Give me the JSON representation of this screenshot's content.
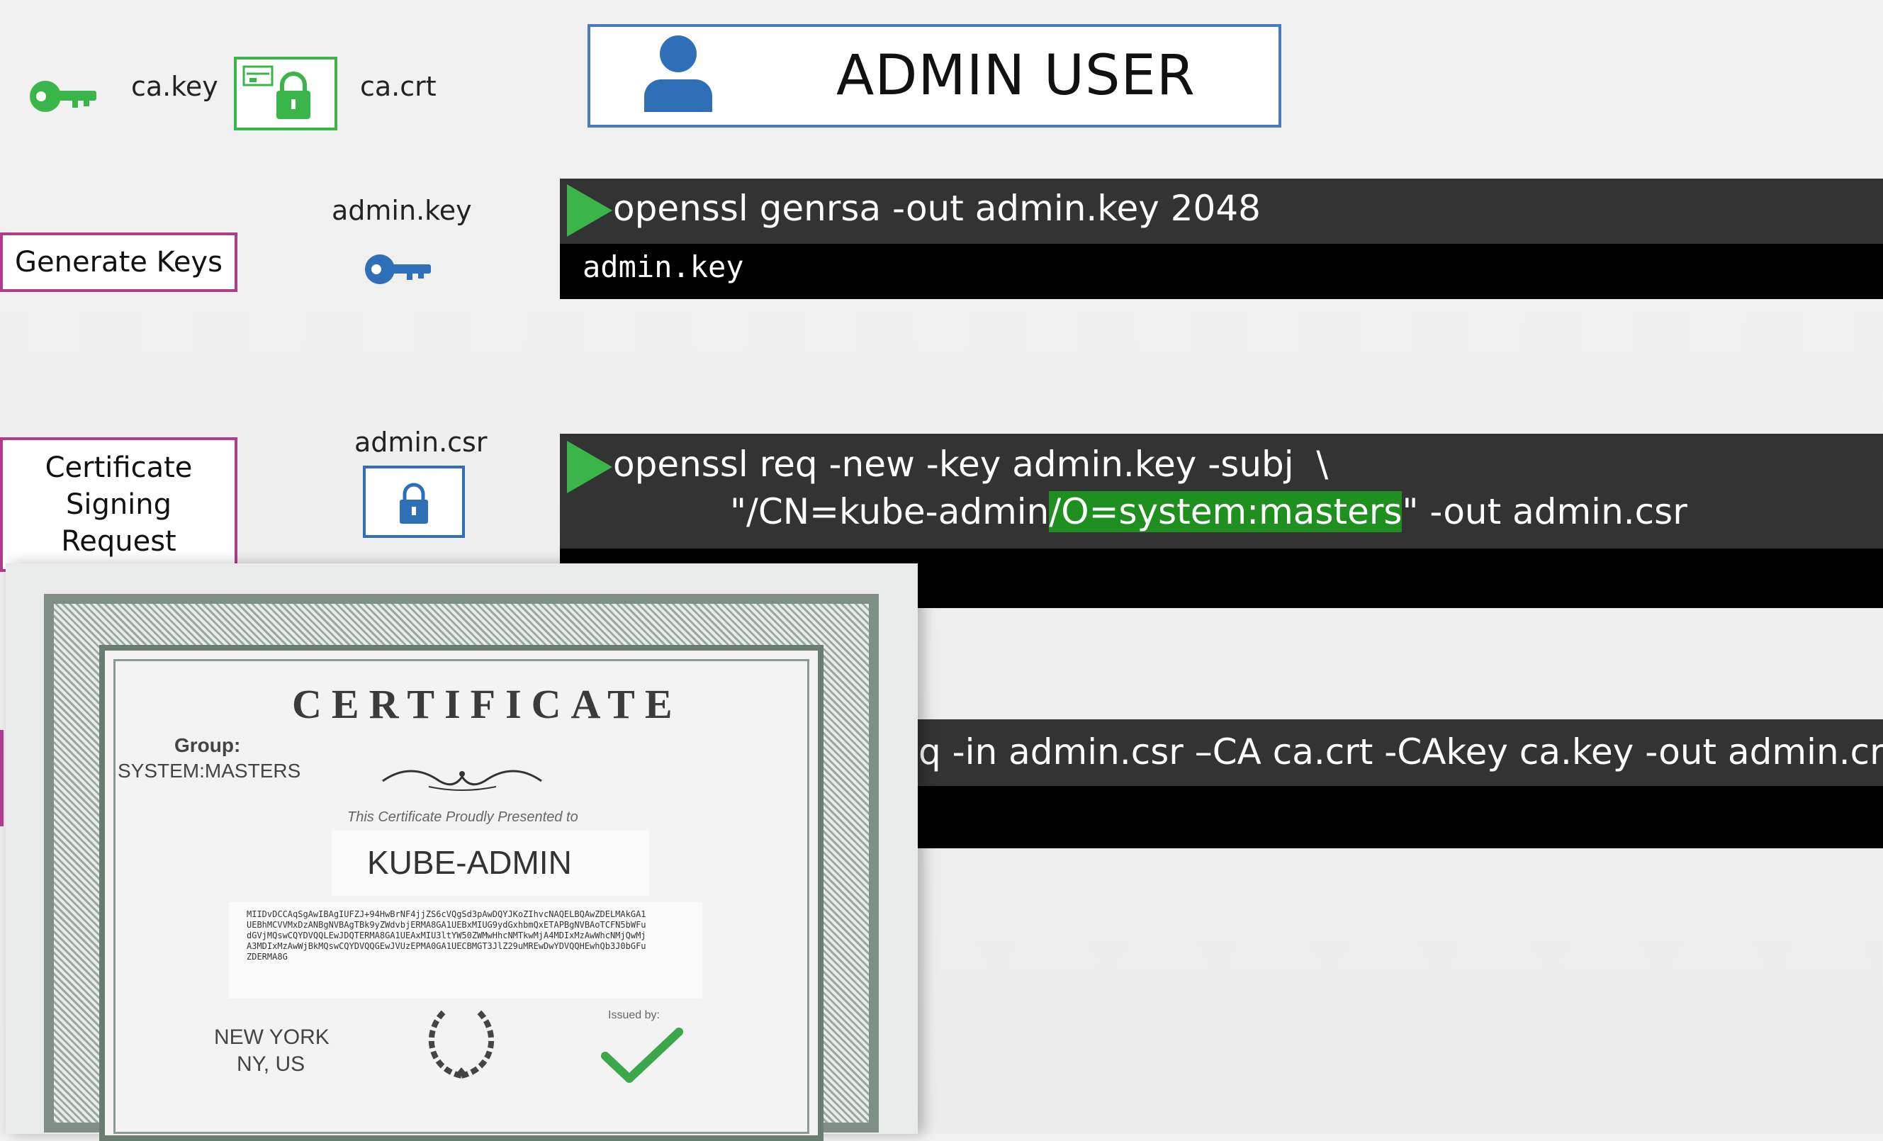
{
  "ca": {
    "key_label": "ca.key",
    "crt_label": "ca.crt"
  },
  "title": "ADMIN USER",
  "steps": {
    "generate_keys": "Generate Keys",
    "csr_line1": "Certificate",
    "csr_line2": "Signing",
    "csr_line3": "Request"
  },
  "files": {
    "admin_key": "admin.key",
    "admin_csr": "admin.csr"
  },
  "terminal1": {
    "command": "openssl genrsa -out admin.key 2048",
    "output": "admin.key"
  },
  "terminal2": {
    "line1": "openssl req -new -key admin.key -subj  \\",
    "line2_pre": "\"/CN=kube-admin",
    "line2_highlight": "/O=system:masters",
    "line2_post": "\" -out admin.csr"
  },
  "terminal3": {
    "command_visible": "q -in admin.csr –CA ca.crt -CAkey ca.key -out admin.crt"
  },
  "certificate": {
    "heading": "CERTIFICATE",
    "group_label": "Group:",
    "group_value": "SYSTEM:MASTERS",
    "presented_to": "This Certificate Proudly Presented to",
    "recipient": "KUBE-ADMIN",
    "hash_text": "MIIDvDCCAqSgAwIBAgIUFZJ+94HwBrNF4jjZS6cVQgSd3pAwDQYJKoZIhvcNAQELBQAwZDELMAkGA1UEBhMCVVMxDzANBgNVBAgTBk9yZWdvbjERMA8GA1UEBxMIUG9ydGxhbmQxETAPBgNVBAoTCFN5bWFudGVjMQswCQYDVQQLEwJDQTERMA8GA1UEAxMIU3ltYW50ZWMwHhcNMTkwMjA4MDIxMzAwWhcNMjQwMjA3MDIxMzAwWjBkMQswCQYDVQQGEwJVUzEPMA0GA1UECBMGT3JlZ29uMREwDwYDVQQHEwhQb3J0bGFuZDERMA8G",
    "location_line1": "NEW YORK",
    "location_line2": "NY, US",
    "issued_by": "Issued by:"
  },
  "colors": {
    "green_accent": "#39b54a",
    "blue_accent": "#4a7bbf",
    "magenta_border": "#b23c8c",
    "terminal_header": "#333333",
    "terminal_body": "#000000",
    "highlight": "#1f8f1f"
  }
}
